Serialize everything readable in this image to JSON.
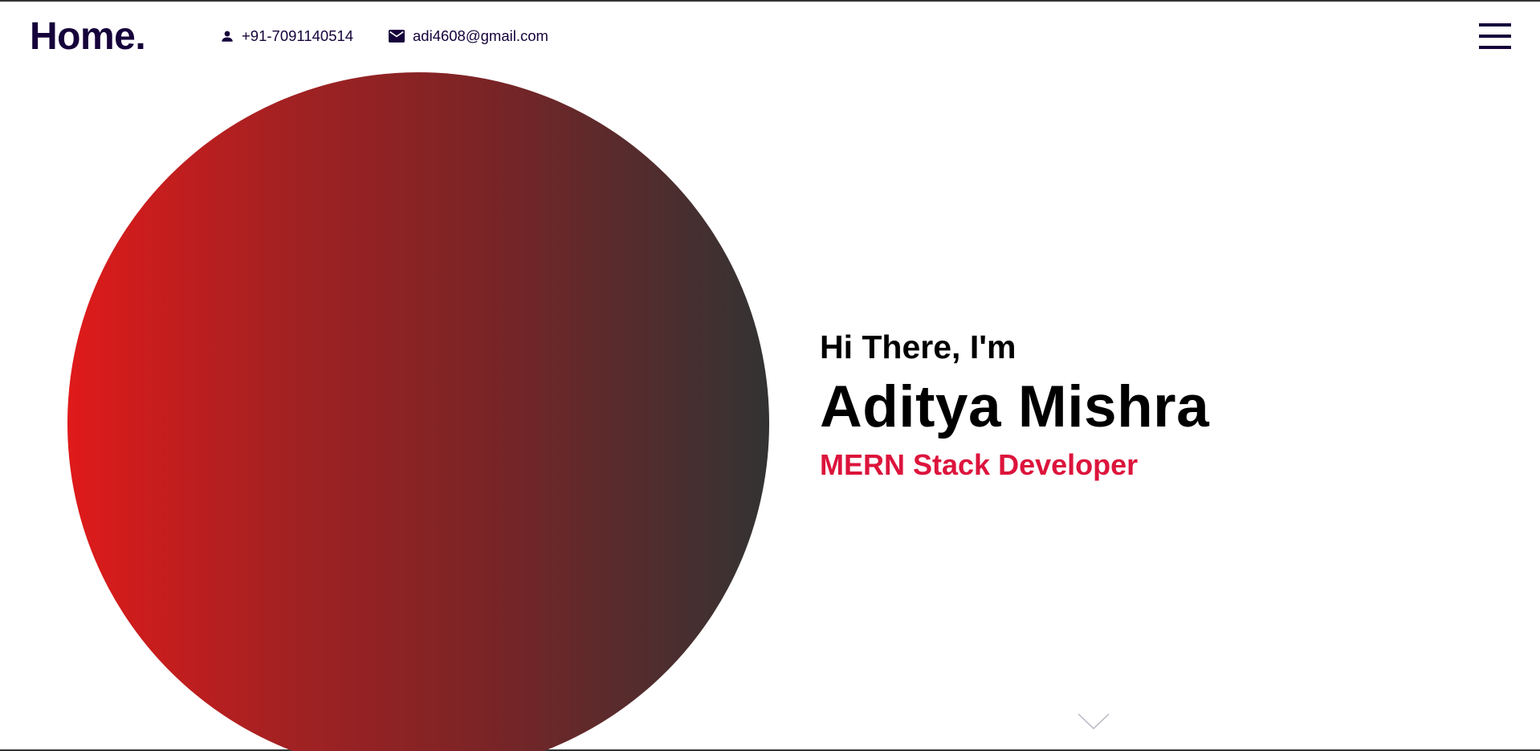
{
  "header": {
    "logo": "Home.",
    "phone": "+91-7091140514",
    "email": "adi4608@gmail.com",
    "menu_icon": "hamburger-menu-icon"
  },
  "hero": {
    "greeting": "Hi There, I'm",
    "name": "Aditya Mishra",
    "role": "MERN Stack Developer",
    "scroll_icon": "chevron-down-icon"
  },
  "colors": {
    "brand_dark": "#15023a",
    "accent": "#dc143c",
    "gradient_start": "#e01a1a",
    "gradient_end": "#333333"
  },
  "icons": {
    "phone": "user-icon",
    "email": "mail-icon"
  }
}
